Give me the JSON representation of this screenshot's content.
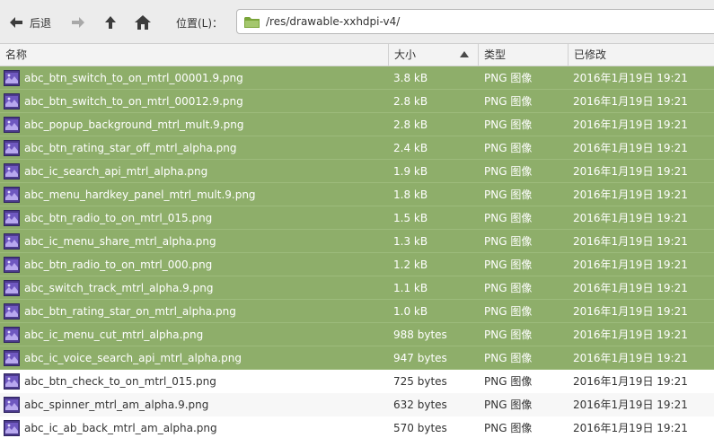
{
  "toolbar": {
    "back_label": "后退",
    "location_label": "位置(L)：",
    "location_path": "/res/drawable-xxhdpi-v4/"
  },
  "columns": {
    "name": "名称",
    "size": "大小",
    "type": "类型",
    "modified": "已修改"
  },
  "files": [
    {
      "name": "abc_btn_switch_to_on_mtrl_00001.9.png",
      "size": "3.8 kB",
      "type": "PNG 图像",
      "modified": "2016年1月19日 19:21",
      "selected": true
    },
    {
      "name": "abc_btn_switch_to_on_mtrl_00012.9.png",
      "size": "2.8 kB",
      "type": "PNG 图像",
      "modified": "2016年1月19日 19:21",
      "selected": true
    },
    {
      "name": "abc_popup_background_mtrl_mult.9.png",
      "size": "2.8 kB",
      "type": "PNG 图像",
      "modified": "2016年1月19日 19:21",
      "selected": true
    },
    {
      "name": "abc_btn_rating_star_off_mtrl_alpha.png",
      "size": "2.4 kB",
      "type": "PNG 图像",
      "modified": "2016年1月19日 19:21",
      "selected": true
    },
    {
      "name": "abc_ic_search_api_mtrl_alpha.png",
      "size": "1.9 kB",
      "type": "PNG 图像",
      "modified": "2016年1月19日 19:21",
      "selected": true
    },
    {
      "name": "abc_menu_hardkey_panel_mtrl_mult.9.png",
      "size": "1.8 kB",
      "type": "PNG 图像",
      "modified": "2016年1月19日 19:21",
      "selected": true
    },
    {
      "name": "abc_btn_radio_to_on_mtrl_015.png",
      "size": "1.5 kB",
      "type": "PNG 图像",
      "modified": "2016年1月19日 19:21",
      "selected": true
    },
    {
      "name": "abc_ic_menu_share_mtrl_alpha.png",
      "size": "1.3 kB",
      "type": "PNG 图像",
      "modified": "2016年1月19日 19:21",
      "selected": true
    },
    {
      "name": "abc_btn_radio_to_on_mtrl_000.png",
      "size": "1.2 kB",
      "type": "PNG 图像",
      "modified": "2016年1月19日 19:21",
      "selected": true
    },
    {
      "name": "abc_switch_track_mtrl_alpha.9.png",
      "size": "1.1 kB",
      "type": "PNG 图像",
      "modified": "2016年1月19日 19:21",
      "selected": true
    },
    {
      "name": "abc_btn_rating_star_on_mtrl_alpha.png",
      "size": "1.0 kB",
      "type": "PNG 图像",
      "modified": "2016年1月19日 19:21",
      "selected": true
    },
    {
      "name": "abc_ic_menu_cut_mtrl_alpha.png",
      "size": "988 bytes",
      "type": "PNG 图像",
      "modified": "2016年1月19日 19:21",
      "selected": true
    },
    {
      "name": "abc_ic_voice_search_api_mtrl_alpha.png",
      "size": "947 bytes",
      "type": "PNG 图像",
      "modified": "2016年1月19日 19:21",
      "selected": true
    },
    {
      "name": "abc_btn_check_to_on_mtrl_015.png",
      "size": "725 bytes",
      "type": "PNG 图像",
      "modified": "2016年1月19日 19:21",
      "selected": false
    },
    {
      "name": "abc_spinner_mtrl_am_alpha.9.png",
      "size": "632 bytes",
      "type": "PNG 图像",
      "modified": "2016年1月19日 19:21",
      "selected": false
    },
    {
      "name": "abc_ic_ab_back_mtrl_am_alpha.png",
      "size": "570 bytes",
      "type": "PNG 图像",
      "modified": "2016年1月19日 19:21",
      "selected": false
    }
  ],
  "icons": {
    "back": "arrow-left-icon",
    "forward": "arrow-right-icon",
    "up": "arrow-up-icon",
    "home": "home-icon",
    "folder": "folder-icon",
    "file": "png-image-icon",
    "sort": "sort-ascending-icon"
  },
  "colors": {
    "selection": "#8eae6a",
    "folder": "#7aa53a"
  }
}
